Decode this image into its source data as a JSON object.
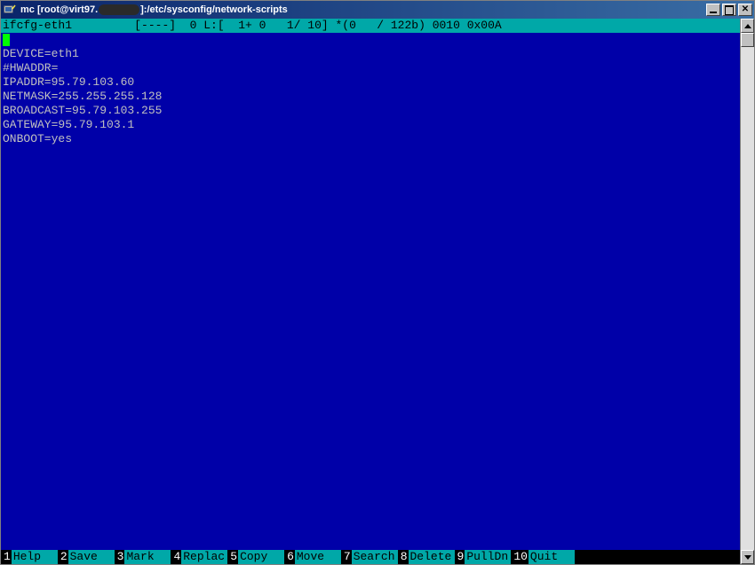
{
  "titlebar": {
    "prefix": "mc [root@virt97.",
    "suffix": "]:/etc/sysconfig/network-scripts"
  },
  "status": {
    "filename": "ifcfg-eth1",
    "info": "[----]  0 L:[  1+ 0   1/ 10] *(0   / 122b) 0010 0x00A"
  },
  "file_lines": [
    "DEVICE=eth1",
    "#HWADDR=",
    "IPADDR=95.79.103.60",
    "NETMASK=255.255.255.128",
    "BROADCAST=95.79.103.255",
    "GATEWAY=95.79.103.1",
    "ONBOOT=yes"
  ],
  "fnkeys": [
    {
      "n": "1",
      "label": "Help"
    },
    {
      "n": "2",
      "label": "Save"
    },
    {
      "n": "3",
      "label": "Mark"
    },
    {
      "n": "4",
      "label": "Replac"
    },
    {
      "n": "5",
      "label": "Copy"
    },
    {
      "n": "6",
      "label": "Move"
    },
    {
      "n": "7",
      "label": "Search"
    },
    {
      "n": "8",
      "label": "Delete"
    },
    {
      "n": "9",
      "label": "PullDn"
    },
    {
      "n": "10",
      "label": "Quit"
    }
  ]
}
